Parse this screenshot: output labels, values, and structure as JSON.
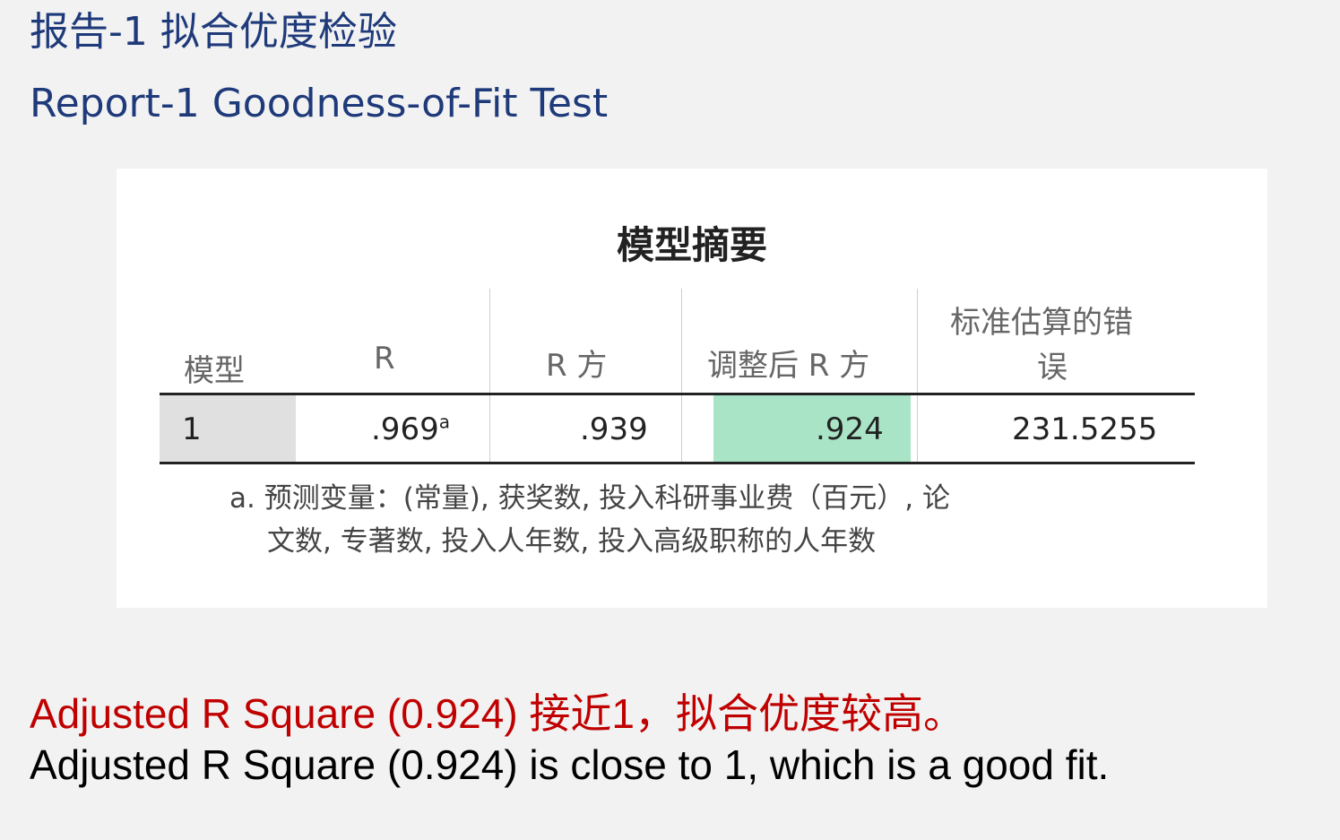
{
  "header": {
    "title_cn": "报告-1 拟合优度检验",
    "title_en": "Report-1 Goodness-of-Fit Test"
  },
  "table": {
    "title": "模型摘要",
    "columns": [
      "模型",
      "R",
      "R 方",
      "调整后 R 方",
      "标准估算的错误"
    ],
    "std_error_header_line1": "标准估算的错",
    "std_error_header_line2": "误",
    "rows": [
      {
        "model": "1",
        "r": ".969",
        "r_superscript": "a",
        "r_square": ".939",
        "adjusted_r_square": ".924",
        "std_error": "231.5255"
      }
    ],
    "footnote_line1": "a. 预测变量：(常量), 获奖数, 投入科研事业费（百元）, 论",
    "footnote_line2": "文数, 专著数, 投入人年数, 投入高级职称的人年数",
    "highlight_color": "#a9e4c6",
    "model_cell_color": "#e0e0e0"
  },
  "summary": {
    "cn": "Adjusted R Square (0.924) 接近1，拟合优度较高。",
    "en": "Adjusted R Square (0.924) is close to 1, which is a good fit.",
    "cn_color": "#c00000",
    "en_color": "#000000"
  }
}
